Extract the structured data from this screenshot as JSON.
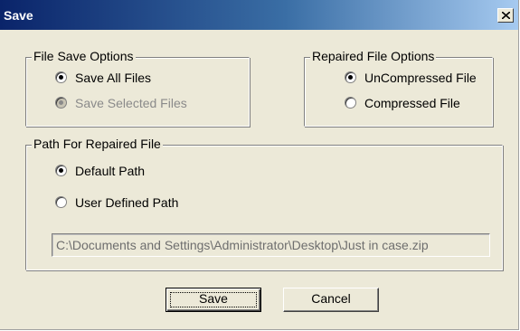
{
  "window": {
    "title": "Save",
    "close_icon": "close-icon"
  },
  "file_save_options": {
    "legend": "File Save Options",
    "options": [
      {
        "label": "Save All Files",
        "checked": true,
        "enabled": true
      },
      {
        "label": "Save Selected Files",
        "checked": true,
        "enabled": false
      }
    ]
  },
  "repaired_file_options": {
    "legend": "Repaired File Options",
    "options": [
      {
        "label": "UnCompressed File",
        "checked": true,
        "enabled": true
      },
      {
        "label": "Compressed File",
        "checked": false,
        "enabled": true
      }
    ]
  },
  "path_group": {
    "legend": "Path For Repaired File",
    "options": [
      {
        "label": "Default Path",
        "checked": true,
        "enabled": true
      },
      {
        "label": "User Defined Path",
        "checked": false,
        "enabled": true
      }
    ],
    "path_value": "C:\\Documents and Settings\\Administrator\\Desktop\\Just in case.zip"
  },
  "buttons": {
    "save_label": "Save",
    "cancel_label": "Cancel"
  },
  "colors": {
    "title_bar_start": "#0a246a",
    "title_bar_end": "#a6caf0",
    "dialog_face": "#ece9d8",
    "disabled_text": "#8a8a8a"
  }
}
